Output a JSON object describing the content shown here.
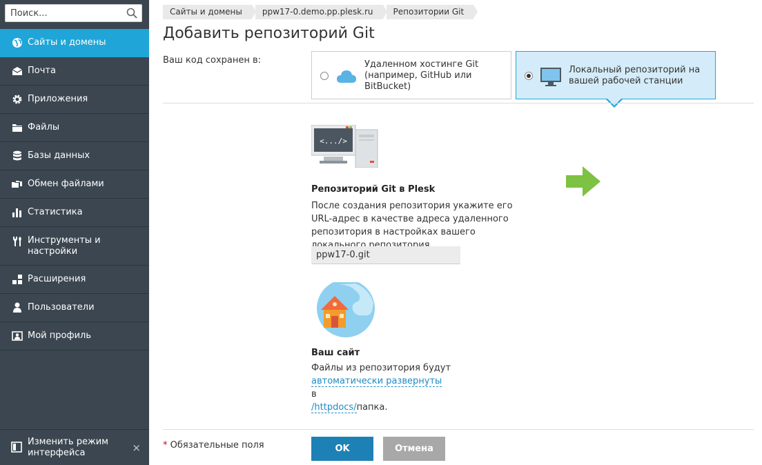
{
  "sidebar": {
    "search_placeholder": "Поиск...",
    "items": [
      {
        "label": "Сайты и домены",
        "icon": "globe-icon",
        "active": true
      },
      {
        "label": "Почта",
        "icon": "mail-icon"
      },
      {
        "label": "Приложения",
        "icon": "gear-icon"
      },
      {
        "label": "Файлы",
        "icon": "folder-icon"
      },
      {
        "label": "Базы данных",
        "icon": "database-icon"
      },
      {
        "label": "Обмен файлами",
        "icon": "file-sharing-icon"
      },
      {
        "label": "Статистика",
        "icon": "chart-icon"
      },
      {
        "label": "Инструменты и настройки",
        "icon": "tools-icon"
      },
      {
        "label": "Расширения",
        "icon": "extensions-icon"
      },
      {
        "label": "Пользователи",
        "icon": "user-icon"
      },
      {
        "label": "Мой профиль",
        "icon": "profile-icon"
      }
    ],
    "bottom_label": "Изменить режим интерфейса",
    "bottom_close": "×"
  },
  "breadcrumbs": [
    "Сайты и домены",
    "ppw17-0.demo.pp.plesk.ru",
    "Репозитории Git"
  ],
  "title": "Добавить репозиторий Git",
  "form": {
    "saved_label": "Ваш код сохранен в:",
    "option_remote": "Удаленном хостинге Git (например, GitHub или BitBucket)",
    "option_local": "Локальный репозиторий на вашей рабочей станции",
    "selected": "local"
  },
  "repo_section": {
    "title": "Репозиторий Git в Plesk",
    "text": "После создания репозитория укажите его URL-адрес в качестве адреса удаленного репозитория в настройках вашего локального репозитория.",
    "git_name": "ppw17-0.git",
    "code_glyph": "<.../>"
  },
  "site_section": {
    "title": "Ваш сайт",
    "text1": "Файлы из репозитория будут",
    "link_deploy": "автоматически развернуты",
    "text2": "в",
    "link_path": "/httpdocs/",
    "text3": "папка."
  },
  "footer": {
    "required_star": "*",
    "required_text": "Обязательные поля",
    "ok": "OK",
    "cancel": "Отмена"
  },
  "colors": {
    "sidebar_bg": "#3b4650",
    "accent": "#1fa5d7",
    "ok_button": "#1d81b6",
    "cancel_button": "#a8a8a8",
    "arrow_green": "#7dc242"
  }
}
